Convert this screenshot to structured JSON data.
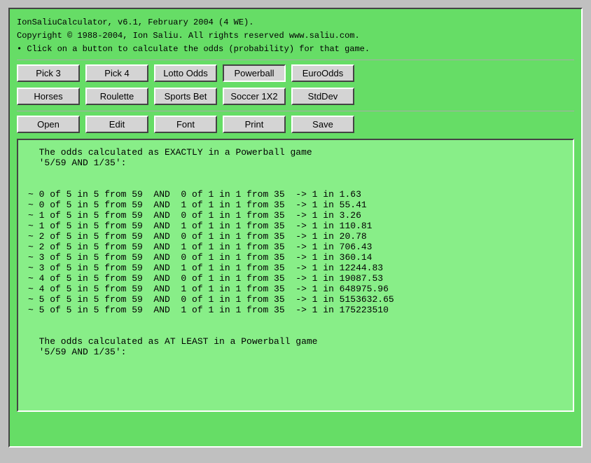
{
  "app": {
    "title_line1": "IonSaliuCalculator, v6.1, February 2004 (4 WE).",
    "title_line2": "Copyright © 1988-2004, Ion Saliu. All rights reserved www.saliu.com.",
    "title_line3": "• Click on a button to calculate the odds (probability) for that game."
  },
  "buttons_row1": [
    {
      "label": "Pick 3",
      "name": "pick3-button",
      "active": false
    },
    {
      "label": "Pick 4",
      "name": "pick4-button",
      "active": false
    },
    {
      "label": "Lotto Odds",
      "name": "lotto-odds-button",
      "active": false
    },
    {
      "label": "Powerball",
      "name": "powerball-button",
      "active": true
    },
    {
      "label": "EuroOdds",
      "name": "euroodds-button",
      "active": false
    }
  ],
  "buttons_row2": [
    {
      "label": "Horses",
      "name": "horses-button",
      "active": false
    },
    {
      "label": "Roulette",
      "name": "roulette-button",
      "active": false
    },
    {
      "label": "Sports Bet",
      "name": "sports-bet-button",
      "active": false
    },
    {
      "label": "Soccer 1X2",
      "name": "soccer-button",
      "active": false
    },
    {
      "label": "StdDev",
      "name": "stddev-button",
      "active": false
    }
  ],
  "buttons_row3": [
    {
      "label": "Open",
      "name": "open-button",
      "active": false
    },
    {
      "label": "Edit",
      "name": "edit-button",
      "active": false
    },
    {
      "label": "Font",
      "name": "font-button",
      "active": false
    },
    {
      "label": "Print",
      "name": "print-button",
      "active": false
    },
    {
      "label": "Save",
      "name": "save-button",
      "active": false
    }
  ],
  "output": {
    "content": "  The odds calculated as EXACTLY in a Powerball game\n  '5/59 AND 1/35':\n\n\n~ 0 of 5 in 5 from 59  AND  0 of 1 in 1 from 35  -> 1 in 1.63\n~ 0 of 5 in 5 from 59  AND  1 of 1 in 1 from 35  -> 1 in 55.41\n~ 1 of 5 in 5 from 59  AND  0 of 1 in 1 from 35  -> 1 in 3.26\n~ 1 of 5 in 5 from 59  AND  1 of 1 in 1 from 35  -> 1 in 110.81\n~ 2 of 5 in 5 from 59  AND  0 of 1 in 1 from 35  -> 1 in 20.78\n~ 2 of 5 in 5 from 59  AND  1 of 1 in 1 from 35  -> 1 in 706.43\n~ 3 of 5 in 5 from 59  AND  0 of 1 in 1 from 35  -> 1 in 360.14\n~ 3 of 5 in 5 from 59  AND  1 of 1 in 1 from 35  -> 1 in 12244.83\n~ 4 of 5 in 5 from 59  AND  0 of 1 in 1 from 35  -> 1 in 19087.53\n~ 4 of 5 in 5 from 59  AND  1 of 1 in 1 from 35  -> 1 in 648975.96\n~ 5 of 5 in 5 from 59  AND  0 of 1 in 1 from 35  -> 1 in 5153632.65\n~ 5 of 5 in 5 from 59  AND  1 of 1 in 1 from 35  -> 1 in 175223510\n\n\n  The odds calculated as AT LEAST in a Powerball game\n  '5/59 AND 1/35':\n"
  }
}
